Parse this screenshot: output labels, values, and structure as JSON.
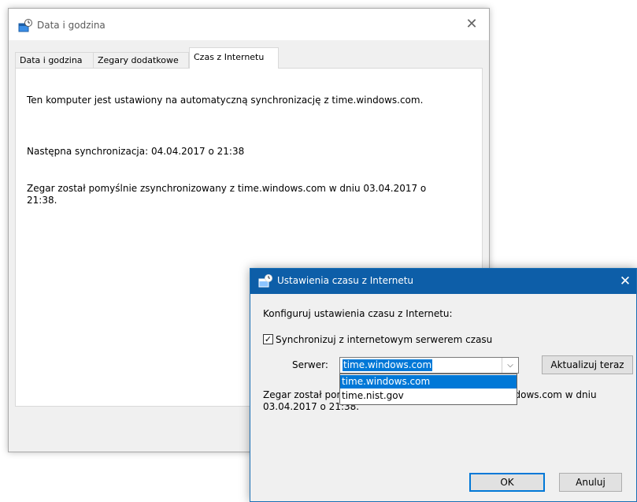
{
  "back_window": {
    "title": "Data i godzina",
    "close_glyph": "✕",
    "tabs": [
      "Data i godzina",
      "Zegary dodatkowe",
      "Czas z Internetu"
    ],
    "active_tab": "Czas z Internetu",
    "line1": "Ten komputer jest ustawiony na automatyczną synchronizację z time.windows.com.",
    "line2": "Następna synchronizacja: 04.04.2017 o 21:38",
    "line3": "Zegar został pomyślnie zsynchronizowany z time.windows.com w dniu 03.04.2017 o 21:38."
  },
  "dialog": {
    "title": "Ustawienia czasu z Internetu",
    "close_glyph": "✕",
    "heading": "Konfiguruj ustawienia czasu z Internetu:",
    "sync_checkbox": {
      "label": "Synchronizuj z internetowym serwerem czasu",
      "checked": true,
      "mark": "✓"
    },
    "server_label": "Serwer:",
    "server_value": "time.windows.com",
    "dropdown_arrow": "⌵",
    "dropdown_options": [
      "time.windows.com",
      "time.nist.gov"
    ],
    "update_button": "Aktualizuj teraz",
    "status_text": "Zegar został pomyślnie zsynchronizowany z time.windows.com w dniu 03.04.2017 o 21:38.",
    "ok_button": "OK",
    "cancel_button": "Anuluj"
  },
  "colors": {
    "dialog_titlebar": "#0d5ea8",
    "selection": "#0078d7",
    "window_bg": "#f0f0f0"
  },
  "icons": [
    "date-time-app-icon",
    "close-icon",
    "checkbox-check-icon",
    "chevron-down-icon"
  ]
}
